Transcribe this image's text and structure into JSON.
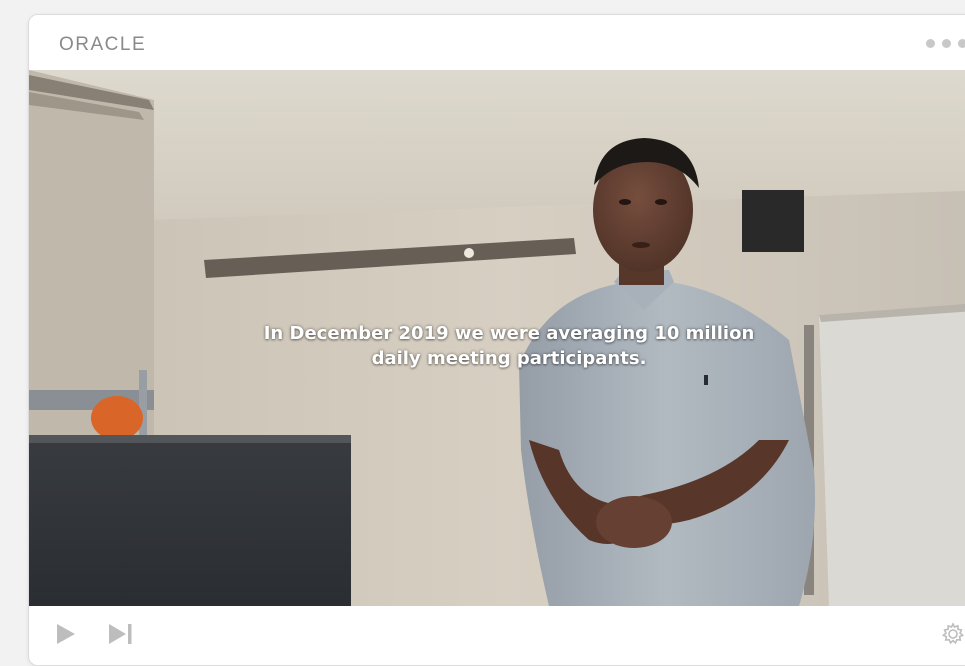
{
  "brand": {
    "name": "ORACLE"
  },
  "video": {
    "caption_line1": "In December 2019 we were averaging 10 million",
    "caption_line2": "daily meeting participants."
  },
  "controls": {
    "play": "play-icon",
    "next": "skip-next-icon",
    "settings": "gear-icon"
  },
  "colors": {
    "icon_gray": "#bdbdbd",
    "brand_gray": "#8a8a8a"
  }
}
